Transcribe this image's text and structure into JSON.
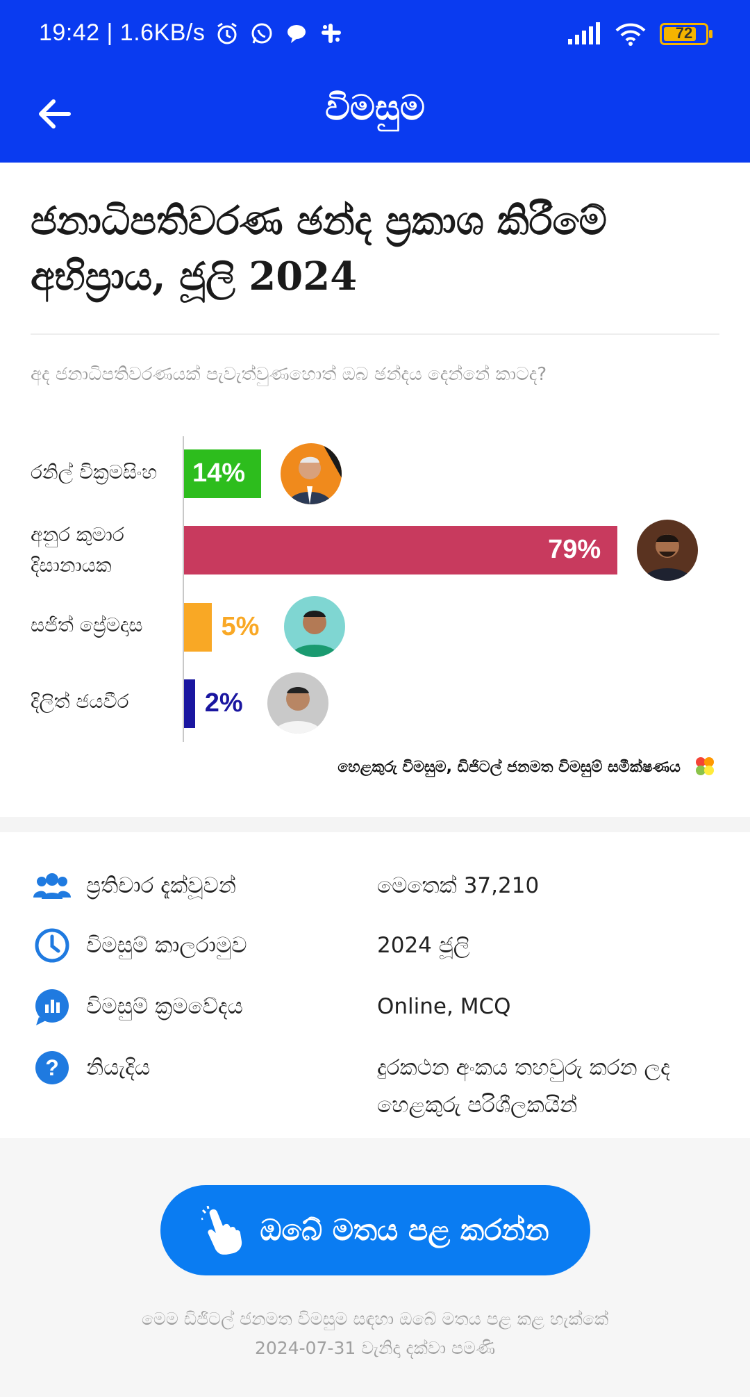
{
  "status_bar": {
    "time_speed": "19:42 | 1.6KB/s",
    "battery_level": "72",
    "icons": [
      "alarm-icon",
      "whatsapp-icon",
      "chat-bubble-icon",
      "slack-icon",
      "signal-icon",
      "wifi-icon",
      "battery-icon"
    ]
  },
  "app_bar": {
    "title": "විමසුම",
    "back_icon": "arrow-left-icon",
    "color": "#0a3bf0"
  },
  "poll": {
    "title_line1": "ජනාධිපතිවරණ ඡන්ද ප්‍රකාශ කිරීමේ",
    "title_line2": "අභිප්‍රාය, ජූලි 2024",
    "question": "අද ජනාධිපතිවරණයක් පැවැත්වුණහොත් ඔබ ඡන්දය දෙන්නේ කාටද?"
  },
  "chart_data": {
    "type": "bar",
    "orientation": "horizontal",
    "categories": [
      "රනිල් වික්‍රමසිංහ",
      "අනුර කුමාර දිසානායක",
      "සජිත් ප්‍රේමදාස",
      "දිලිත් ජයවීර"
    ],
    "values": [
      14,
      79,
      5,
      2
    ],
    "value_labels": [
      "14%",
      "79%",
      "5%",
      "2%"
    ],
    "colors": [
      "#2dbd1d",
      "#c83a5e",
      "#f9a825",
      "#1a16a0"
    ],
    "unit": "%",
    "xlim": [
      0,
      100
    ],
    "grid": false,
    "legend": "none"
  },
  "chart_labels": {
    "cand1_line1": "රනිල් වික්‍රමසිංහ",
    "cand2_line1": "අනුර කුමාර",
    "cand2_line2": "දිසානායක",
    "cand3_line1": "සජිත් ප්‍රේමදාස",
    "cand4_line1": "දිලිත් ජයවීර"
  },
  "source": {
    "text": "හෙළකුරු විමසුම, ඩිජිටල් ජනමත විමසුම් සමීක්ෂණය"
  },
  "info": [
    {
      "icon": "people-icon",
      "label": "ප්‍රතිචාර දැක්වූවන්",
      "value": "මෙතෙක් 37,210"
    },
    {
      "icon": "clock-icon",
      "label": "විමසුම් කාලරාමුව",
      "value": "2024 ජූලි"
    },
    {
      "icon": "chart-bubble-icon",
      "label": "විමසුම් ක්‍රමවේදය",
      "value": "Online, MCQ"
    },
    {
      "icon": "question-icon",
      "label": "නියැදිය",
      "value_line1": "දුරකථන අංකය තහවුරු කරන ලද",
      "value_line2": "හෙළකුරු පරිශීලකයින්"
    }
  ],
  "cta": {
    "label": "ඔබේ මතය පළ කරන්න",
    "icon": "hand-pointer-icon",
    "color": "#0a7cf2"
  },
  "footnote": {
    "line1": "මෙම ඩිජිටල් ජනමත විමසුම සඳහා ඔබේ මතය පළ කළ හැක්කේ",
    "line2": "2024-07-31 වැනිදා දක්වා පමණි"
  }
}
